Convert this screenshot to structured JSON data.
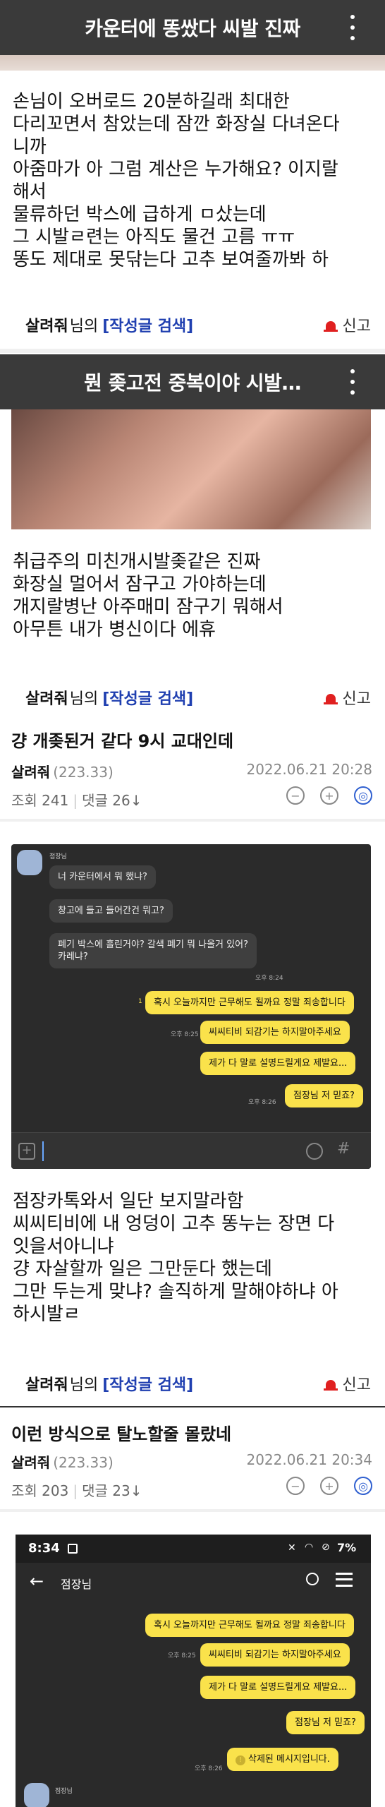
{
  "post1": {
    "bar_title": "카운터에 똥쌌다 씨발 진짜",
    "body": "손님이 오버로드 20분하길래 최대한\n다리꼬면서 참았는데 잠깐 화장실 다녀온다\n니까\n아줌마가 아 그럼 계산은 누가해요? 이지랄\n해서\n물류하던 박스에 급하게 ㅁ샀는데\n그 시발ㄹ련는 아직도 물건 고름 ㅠㅠ\n똥도 제대로 못닦는다 고추 보여줄까봐 하",
    "nick": "살려줘",
    "suffix": "님의",
    "search": "[작성글 검색]",
    "report": "신고"
  },
  "post2": {
    "bar_title": "뭔 좆고전 중복이야 시발…",
    "body": "취급주의 미친개시발좆같은 진짜\n화장실 멀어서 잠구고 가야하는데\n개지랄병난 아주매미 잠구기 뭐해서\n아무튼 내가 병신이다 에휴",
    "nick": "살려줘",
    "suffix": "님의",
    "search": "[작성글 검색]",
    "report": "신고"
  },
  "post3": {
    "title": "걍 개좆된거 같다 9시 교대인데",
    "author": "살려줘",
    "level": "(223.33)",
    "date": "2022.06.21 20:28",
    "views": "조회 241",
    "comments": "댓글 26↓",
    "chat": {
      "sender": "점장님",
      "incoming": [
        "너 카운터에서 뭐 했냐?",
        "창고에 들고 들어간건 뭐고?",
        "폐기 박스에 흘린거야? 갈색 폐기 뭐 나올거 있어?\n카레냐?"
      ],
      "outgoing": [
        "혹시 오늘까지만 근무해도 될까요 정말 죄송합니다",
        "씨씨티비 되감기는 하지말아주세요",
        "제가 다 말로 설명드릴게요 제발요...",
        "점장님 저 믿죠?"
      ],
      "times": [
        "오후 8:24",
        "오후 8:25",
        "오후 8:26"
      ],
      "read": "1"
    },
    "body": "점장카톡와서 일단 보지말라함\n씨씨티비에 내 엉덩이 고추 똥누는 장면 다\n잇을서아니냐\n걍 자살할까 일은 그만둔다 했는데\n그만 두는게 맞냐? 솔직하게 말해야하냐 아\n하시발ㄹ",
    "nick": "살려줘",
    "suffix": "님의",
    "search": "[작성글 검색]",
    "report": "신고"
  },
  "post4": {
    "title": "이런 방식으로 탈노할줄 몰랐네",
    "author": "살려줘",
    "level": "(223.33)",
    "date": "2022.06.21 20:34",
    "views": "조회 203",
    "comments": "댓글 23↓",
    "phone": {
      "time": "8:34",
      "battery": "7%",
      "chat_title": "점장님",
      "outgoing": [
        "혹시 오늘까지만 근무해도 될까요 정말 죄송합니다",
        "씨씨티비 되감기는 하지말아주세요",
        "제가 다 말로 설명드릴게요 제발요...",
        "점장님 저 믿죠?"
      ],
      "deleted": "삭제된 메시지입니다.",
      "times": [
        "오후 8:25",
        "오후 8:26"
      ],
      "sender": "점장님"
    }
  }
}
